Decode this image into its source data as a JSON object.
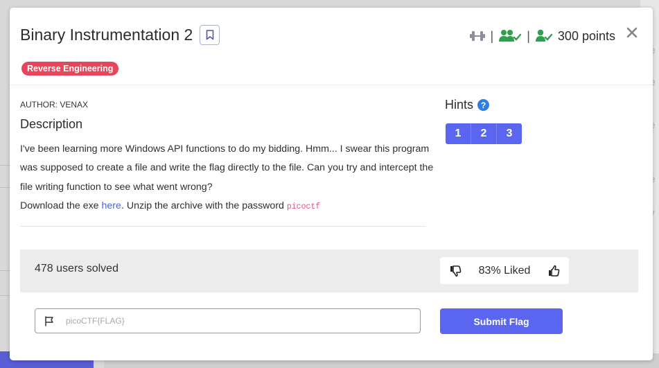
{
  "challenge": {
    "title": "Binary Instrumentation 2",
    "points_label": "300 points",
    "separator": "|",
    "category_tag": "Reverse Engineering",
    "author": "AUTHOR: VENAX",
    "description_heading": "Description",
    "description_lines": [
      "I've been learning more Windows API functions to do my bidding. Hmm... I swear this program was supposed to create a file and write the flag directly to the file. Can you try and intercept the file writing function to see what went wrong?"
    ],
    "download_prefix": "Download the exe ",
    "download_link": "here",
    "download_suffix": ". Unzip the archive with the password ",
    "password": "picoctf"
  },
  "hints": {
    "heading": "Hints",
    "help_icon_glyph": "?",
    "items": [
      {
        "label": "1"
      },
      {
        "label": "2"
      },
      {
        "label": "3"
      }
    ]
  },
  "stats": {
    "solved": "478 users solved",
    "liked": "83% Liked"
  },
  "flag_form": {
    "placeholder": "picoCTF{FLAG}",
    "value": "",
    "submit_label": "Submit Flag"
  },
  "icons": {
    "difficulty": "dumbbell-icon",
    "users_solved": "users-check-icon",
    "user_solved": "user-check-icon",
    "close": "close-icon",
    "bookmark": "bookmark-icon",
    "thumbs_down": "thumbs-down-icon",
    "thumbs_up": "thumbs-up-icon",
    "flag": "flag-icon"
  },
  "colors": {
    "accent": "#5a66f0",
    "tag": "#e8455b",
    "success": "#2e9e4f",
    "link": "#4a63d6",
    "code": "#e0527a",
    "help": "#2f7fe0"
  },
  "background": {
    "side_glyphs": [
      "e",
      "e",
      "e",
      "e",
      "y"
    ]
  }
}
